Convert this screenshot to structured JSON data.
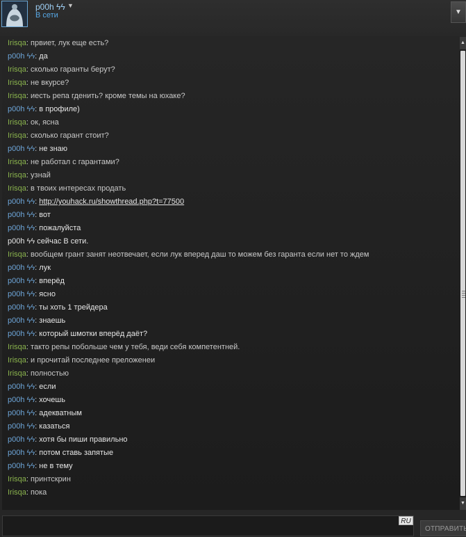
{
  "header": {
    "username": "p00h ϟϟ",
    "status": "В сети",
    "menu_icon": "triangle-down-icon"
  },
  "chat": {
    "messages": [
      {
        "sender": "Irisqa",
        "who": "other",
        "text": "првиет, лук еще есть?"
      },
      {
        "sender": "p00h ϟϟ",
        "who": "me",
        "text": "да"
      },
      {
        "sender": "Irisqa",
        "who": "other",
        "text": "сколько гаранты берут?"
      },
      {
        "sender": "Irisqa",
        "who": "other",
        "text": "не вкурсе?"
      },
      {
        "sender": "Irisqa",
        "who": "other",
        "text": "иесть репа гденить? кроме темы на юхаке?"
      },
      {
        "sender": "p00h ϟϟ",
        "who": "me",
        "text": "в профиле)"
      },
      {
        "sender": "Irisqa",
        "who": "other",
        "text": "ок, ясна"
      },
      {
        "sender": "Irisqa",
        "who": "other",
        "text": "сколько гарант стоит?"
      },
      {
        "sender": "p00h ϟϟ",
        "who": "me",
        "text": "не знаю"
      },
      {
        "sender": "Irisqa",
        "who": "other",
        "text": "не работал с гарантами?"
      },
      {
        "sender": "Irisqa",
        "who": "other",
        "text": "узнай"
      },
      {
        "sender": "Irisqa",
        "who": "other",
        "text": "в твоих интересах продать"
      },
      {
        "sender": "p00h ϟϟ",
        "who": "me",
        "text": "http://youhack.ru/showthread.php?t=77500",
        "link": true
      },
      {
        "sender": "p00h ϟϟ",
        "who": "me",
        "text": "вот"
      },
      {
        "sender": "p00h ϟϟ",
        "who": "me",
        "text": "пожалуйста"
      },
      {
        "sender": "",
        "who": "system",
        "text": "p00h ϟϟ сейчас В сети."
      },
      {
        "sender": "Irisqa",
        "who": "other",
        "text": "вообщем грант занят неотвечает, если лук вперед даш то можем без гаранта если нет то ждем"
      },
      {
        "sender": "p00h ϟϟ",
        "who": "me",
        "text": "лук"
      },
      {
        "sender": "p00h ϟϟ",
        "who": "me",
        "text": "вперёд"
      },
      {
        "sender": "p00h ϟϟ",
        "who": "me",
        "text": "ясно"
      },
      {
        "sender": "p00h ϟϟ",
        "who": "me",
        "text": "ты хоть 1 трейдера"
      },
      {
        "sender": "p00h ϟϟ",
        "who": "me",
        "text": "знаешь"
      },
      {
        "sender": "p00h ϟϟ",
        "who": "me",
        "text": "который шмотки вперёд даёт?"
      },
      {
        "sender": "Irisqa",
        "who": "other",
        "text": "такто репы побольше чем у тебя, веди себя компетентней."
      },
      {
        "sender": "Irisqa",
        "who": "other",
        "text": "и прочитай последнее преложенеи"
      },
      {
        "sender": "Irisqa",
        "who": "other",
        "text": "полностью"
      },
      {
        "sender": "p00h ϟϟ",
        "who": "me",
        "text": "если"
      },
      {
        "sender": "p00h ϟϟ",
        "who": "me",
        "text": "хочешь"
      },
      {
        "sender": "p00h ϟϟ",
        "who": "me",
        "text": "адекватным"
      },
      {
        "sender": "p00h ϟϟ",
        "who": "me",
        "text": "казаться"
      },
      {
        "sender": "p00h ϟϟ",
        "who": "me",
        "text": "хотя бы пиши правильно"
      },
      {
        "sender": "p00h ϟϟ",
        "who": "me",
        "text": "потом ставь запятые"
      },
      {
        "sender": "p00h ϟϟ",
        "who": "me",
        "text": "не в тему"
      },
      {
        "sender": "Irisqa",
        "who": "other",
        "text": "принтскрин"
      },
      {
        "sender": "Irisqa",
        "who": "other",
        "text": "пока"
      }
    ]
  },
  "input": {
    "value": "",
    "language_badge": "RU",
    "send_label": "ОТПРАВИТЬ"
  },
  "colors": {
    "other_sender": "#8ab34d",
    "me_sender": "#6da5d8",
    "status": "#57a8e6",
    "background": "#262626"
  }
}
